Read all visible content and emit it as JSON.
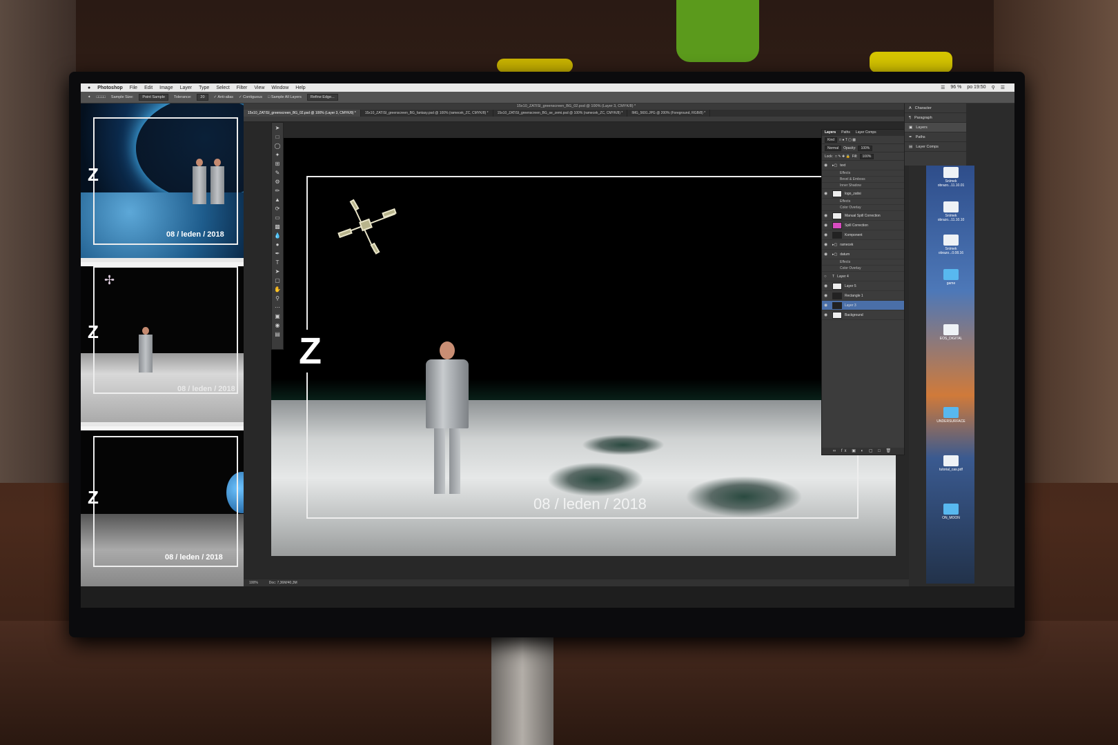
{
  "menubar": {
    "apple": "",
    "app_name": "Photoshop",
    "items": [
      "File",
      "Edit",
      "Image",
      "Layer",
      "Type",
      "Select",
      "Filter",
      "View",
      "Window",
      "Help"
    ],
    "battery": "96 %",
    "clock": "po 19:50"
  },
  "options_bar": {
    "sample_size_label": "Sample Size:",
    "sample_size_value": "Point Sample",
    "tolerance_label": "Tolerance:",
    "tolerance_value": "20",
    "anti_alias": "Anti-alias",
    "contiguous": "Contiguous",
    "sample_all_layers": "Sample All Layers",
    "refine_edge": "Refine Edge..."
  },
  "window_title": "15x10_ZATISI_greenscreen_BG_02.psd @ 100% (Layer 3, CMYK/8) *",
  "tabs": [
    "15x10_ZATISI_greenscreen_BG_02.psd @ 100% (Layer 3, CMYK/8) *",
    "15x10_ZATISI_greenscreen_BG_fantasy.psd @ 100% (ramecek_ZC, CMYK/8) *",
    "15x10_ZATISI_greenscreen_BG_se_zemi.psd @ 100% (ramecek_ZC, CMYK/8) *",
    "IMG_5691.JPG @ 200% (Foreground, RGB/8) *"
  ],
  "canvas": {
    "z_letter": "Z",
    "date_text": "08 / leden / 2018"
  },
  "thumbnails": [
    {
      "z": "Z",
      "date": "08 / leden / 2018"
    },
    {
      "z": "Z",
      "date": "08 / leden / 2018"
    },
    {
      "z": "Z",
      "date": "08 / leden / 2018"
    }
  ],
  "status_bar": {
    "zoom": "100%",
    "doc": "Doc: 7,36M/40,3M"
  },
  "layers_panel": {
    "tabs": [
      "Layers",
      "Paths",
      "Layer Comps"
    ],
    "kind_label": "Kind",
    "blend_mode": "Normal",
    "opacity_label": "Opacity:",
    "opacity_value": "100%",
    "lock_label": "Lock:",
    "fill_label": "Fill:",
    "fill_value": "100%",
    "layers": [
      {
        "name": "text",
        "type": "folder"
      },
      {
        "name": "Effects",
        "type": "sub"
      },
      {
        "name": "Bevel & Emboss",
        "type": "sub"
      },
      {
        "name": "Inner Shadow",
        "type": "sub"
      },
      {
        "name": "logo_zatisi",
        "type": "layer"
      },
      {
        "name": "Effects",
        "type": "sub"
      },
      {
        "name": "Color Overlay",
        "type": "sub"
      },
      {
        "name": "Manual Spill Correction",
        "type": "layer"
      },
      {
        "name": "Spill Correction",
        "type": "layer-pink"
      },
      {
        "name": "Komponent",
        "type": "layer-dark"
      },
      {
        "name": "ramecek",
        "type": "folder"
      },
      {
        "name": "datum",
        "type": "folder"
      },
      {
        "name": "Effects",
        "type": "sub"
      },
      {
        "name": "Color Overlay",
        "type": "sub"
      },
      {
        "name": "Layer 4",
        "type": "text"
      },
      {
        "name": "Layer 5",
        "type": "layer"
      },
      {
        "name": "Rectangle 1",
        "type": "layer-dark"
      },
      {
        "name": "Layer 3",
        "type": "selected"
      },
      {
        "name": "Background",
        "type": "layer"
      }
    ]
  },
  "dock": {
    "items": [
      "Character",
      "Paragraph",
      "Layers",
      "Paths",
      "Layer Comps"
    ]
  },
  "desktop_icons": [
    {
      "label": "Snímek obrazo...11.10.01",
      "kind": "file"
    },
    {
      "label": "Snímek obrazo...11.10.10",
      "kind": "file"
    },
    {
      "label": "Snímek obrazo...0.08.16",
      "kind": "file"
    },
    {
      "label": "game",
      "kind": "folder"
    },
    {
      "label": "EOS_DIGITAL",
      "kind": "file"
    },
    {
      "label": "UNDERSURFACE",
      "kind": "folder"
    },
    {
      "label": "tutorial_cas.pdf",
      "kind": "file"
    },
    {
      "label": "ON_MOON",
      "kind": "folder"
    }
  ]
}
